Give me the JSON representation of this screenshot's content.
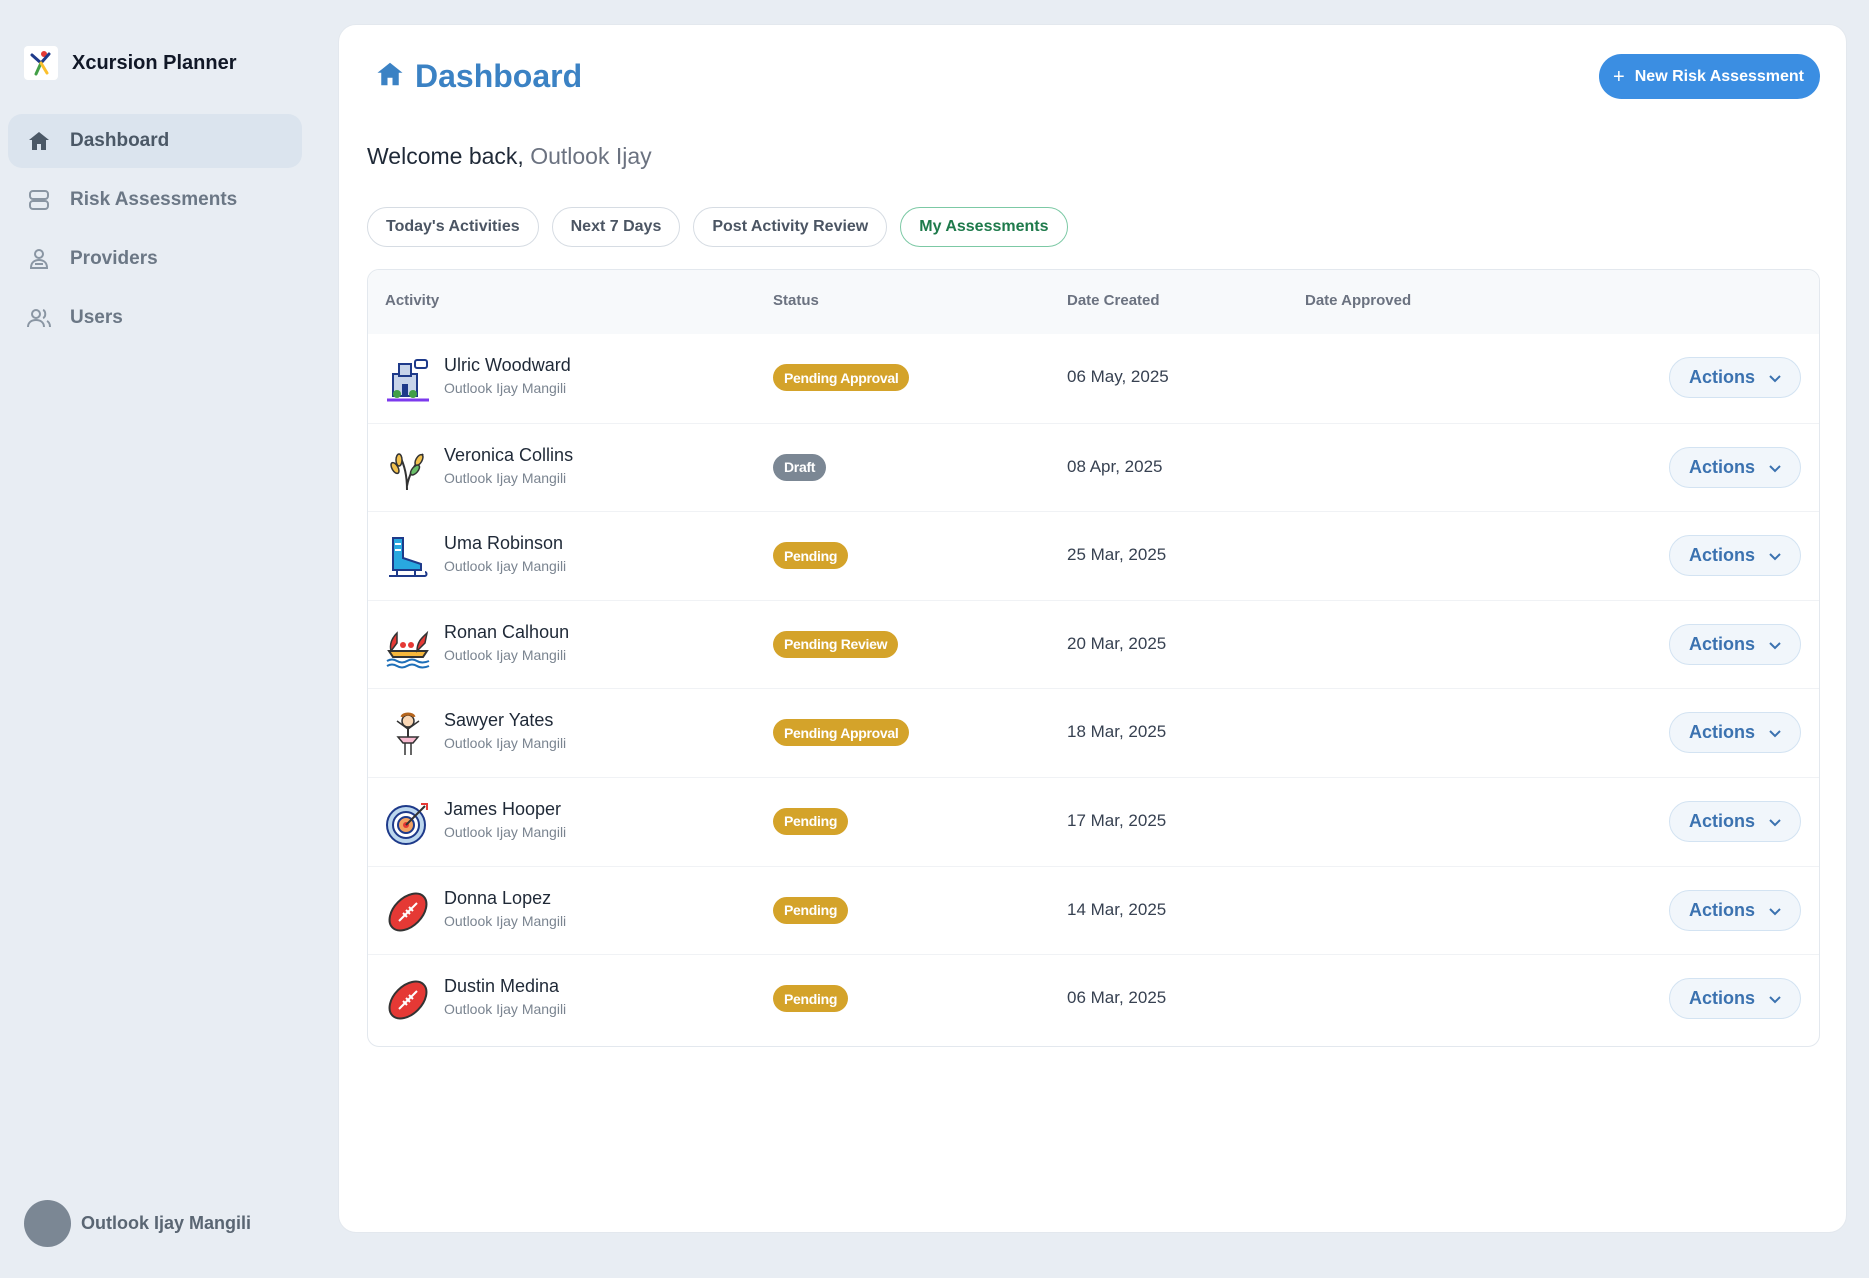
{
  "brand": {
    "name": "Xcursion Planner"
  },
  "sidebar": {
    "items": [
      {
        "label": "Dashboard",
        "icon": "home-icon",
        "active": true
      },
      {
        "label": "Risk Assessments",
        "icon": "database-icon"
      },
      {
        "label": "Providers",
        "icon": "providers-icon"
      },
      {
        "label": "Users",
        "icon": "users-icon"
      }
    ],
    "user": {
      "name": "Outlook Ijay Mangili"
    }
  },
  "header": {
    "title": "Dashboard",
    "new_button": "New Risk Assessment",
    "welcome_prefix": "Welcome back,",
    "welcome_name": "Outlook Ijay"
  },
  "tabs": [
    {
      "label": "Today's Activities"
    },
    {
      "label": "Next 7 Days"
    },
    {
      "label": "Post Activity Review"
    },
    {
      "label": "My Assessments",
      "active": true
    }
  ],
  "table": {
    "columns": [
      "Activity",
      "Status",
      "Date Created",
      "Date Approved"
    ],
    "rows": [
      {
        "name": "Ulric Woodward",
        "sub": "Outlook Ijay Mangili",
        "status": "Pending Approval",
        "created": "06 May, 2025",
        "approved": "",
        "icon": "castle-icon",
        "action": "Actions"
      },
      {
        "name": "Veronica Collins",
        "sub": "Outlook Ijay Mangili",
        "status": "Draft",
        "created": "08 Apr, 2025",
        "approved": "",
        "icon": "wheat-icon",
        "action": "Actions"
      },
      {
        "name": "Uma Robinson",
        "sub": "Outlook Ijay Mangili",
        "status": "Pending",
        "created": "25 Mar, 2025",
        "approved": "",
        "icon": "ice-skate-icon",
        "action": "Actions"
      },
      {
        "name": "Ronan Calhoun",
        "sub": "Outlook Ijay Mangili",
        "status": "Pending Review",
        "created": "20 Mar, 2025",
        "approved": "",
        "icon": "dragon-boat-icon",
        "action": "Actions"
      },
      {
        "name": "Sawyer Yates",
        "sub": "Outlook Ijay Mangili",
        "status": "Pending Approval",
        "created": "18 Mar, 2025",
        "approved": "",
        "icon": "ballerina-icon",
        "action": "Actions"
      },
      {
        "name": "James Hooper",
        "sub": "Outlook Ijay Mangili",
        "status": "Pending",
        "created": "17 Mar, 2025",
        "approved": "",
        "icon": "archery-target-icon",
        "action": "Actions"
      },
      {
        "name": "Donna Lopez",
        "sub": "Outlook Ijay Mangili",
        "status": "Pending",
        "created": "14 Mar, 2025",
        "approved": "",
        "icon": "rugby-ball-icon",
        "action": "Actions"
      },
      {
        "name": "Dustin Medina",
        "sub": "Outlook Ijay Mangili",
        "status": "Pending",
        "created": "06 Mar, 2025",
        "approved": "",
        "icon": "rugby-ball-icon",
        "action": "Actions"
      }
    ]
  },
  "colors": {
    "accent": "#3b8ee2",
    "title": "#3b82c4",
    "pending": "#d4a32a",
    "draft": "#7b8794",
    "active_tab": "#1e7a4b"
  }
}
